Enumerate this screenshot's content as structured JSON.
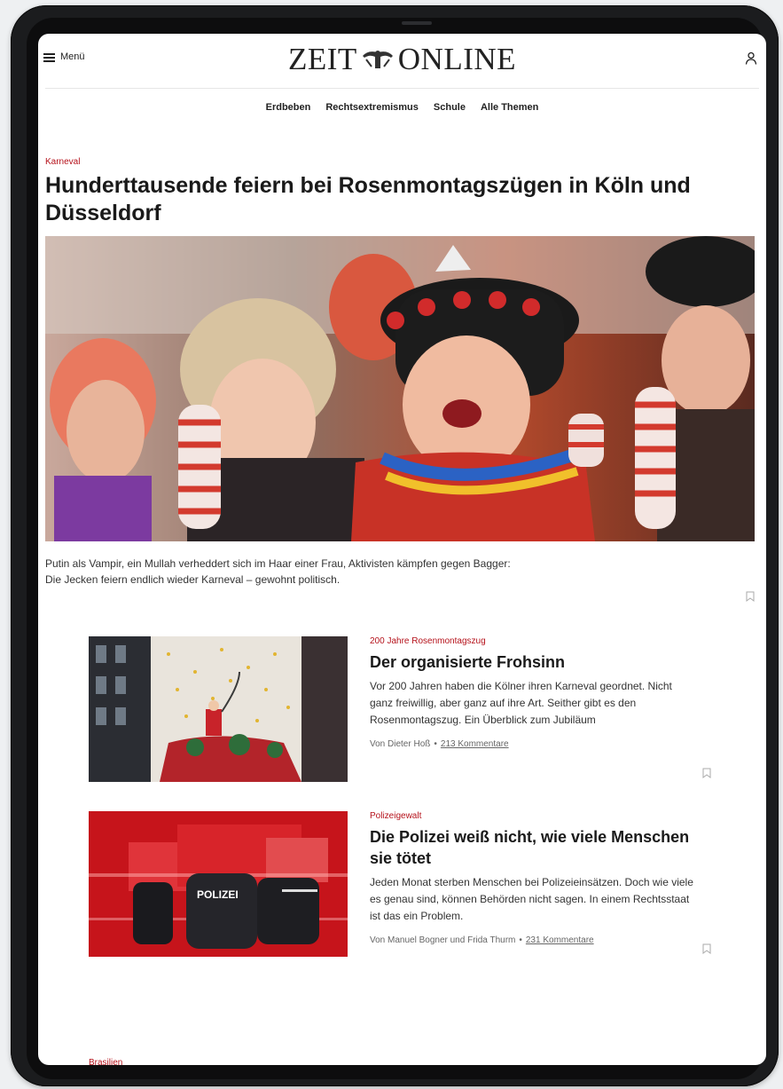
{
  "header": {
    "menu_label": "Menü",
    "logo_left": "ZEIT",
    "logo_right": "ONLINE"
  },
  "topics": [
    "Erdbeben",
    "Rechtsextremismus",
    "Schule",
    "Alle Themen"
  ],
  "lead": {
    "kicker": "Karneval",
    "title": "Hunderttausende feiern bei Rosenmontagszügen in Köln und Düsseldorf",
    "teaser_line1": "Putin als Vampir, ein Mullah verheddert sich im Haar einer Frau, Aktivisten kämpfen gegen Bagger:",
    "teaser_line2": "Die Jecken feiern endlich wieder Karneval – gewohnt politisch."
  },
  "articles": [
    {
      "kicker": "200 Jahre Rosenmontagszug",
      "title": "Der organisierte Frohsinn",
      "text": "Vor 200 Jahren haben die Kölner ihren Karneval geordnet. Nicht ganz freiwillig, aber ganz auf ihre Art. Seither gibt es den Rosenmontagszug. Ein Überblick zum Jubiläum",
      "author": "Von Dieter Hoß",
      "comments": "213 Kommentare"
    },
    {
      "kicker": "Polizeigewalt",
      "title": "Die Polizei weiß nicht, wie viele Menschen sie tötet",
      "text": "Jeden Monat sterben Menschen bei Polizeieinsätzen. Doch wie viele es genau sind, können Behörden nicht sagen. In einem Rechtsstaat ist das ein Problem.",
      "author": "Von Manuel Bogner und Frida Thurm",
      "comments": "231 Kommentare",
      "image_text": "POLIZEI"
    }
  ],
  "next_kicker": "Brasilien",
  "colors": {
    "accent": "#b5121b",
    "text": "#1a1a1a"
  },
  "icons": [
    "menu-icon",
    "user-icon",
    "bookmark-icon"
  ]
}
